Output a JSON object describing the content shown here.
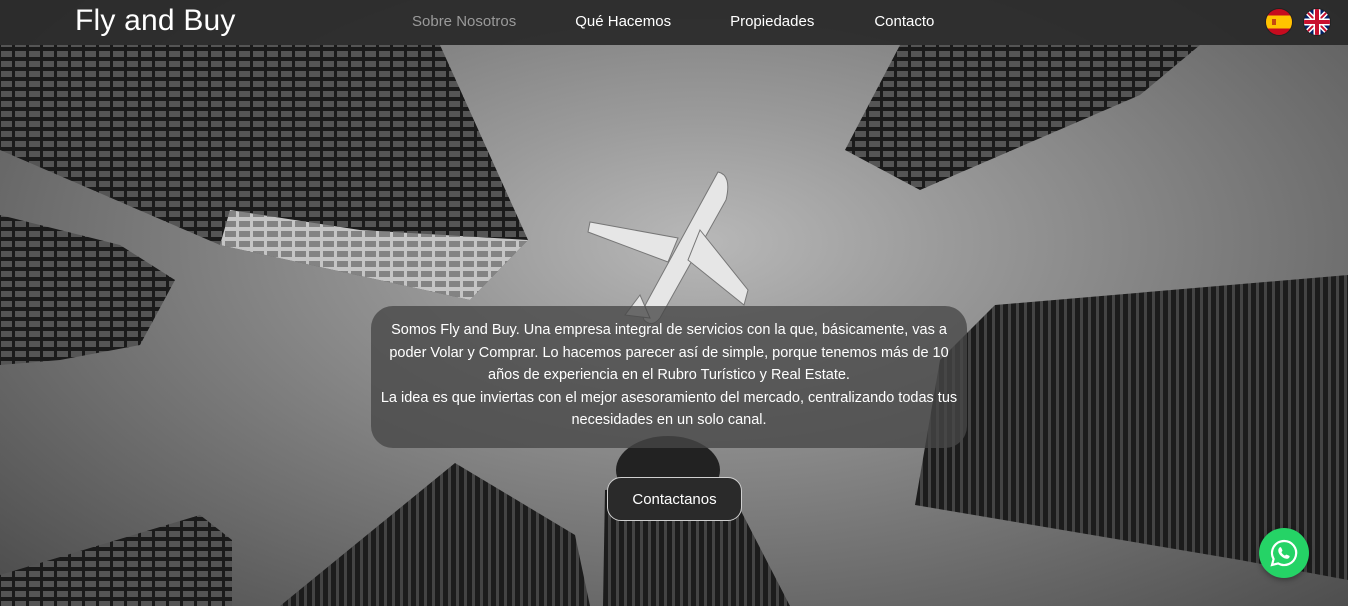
{
  "header": {
    "brand": "Fly and Buy",
    "nav": [
      {
        "label": "Sobre Nosotros",
        "active": true
      },
      {
        "label": "Qué Hacemos",
        "active": false
      },
      {
        "label": "Propiedades",
        "active": false
      },
      {
        "label": "Contacto",
        "active": false
      }
    ],
    "languages": [
      {
        "icon": "spain-flag-icon",
        "code": "es"
      },
      {
        "icon": "uk-flag-icon",
        "code": "en"
      }
    ]
  },
  "hero": {
    "intro_line1": "Somos Fly and Buy. Una empresa integral de servicios con la que, básicamente, vas a poder Volar y Comprar. Lo hacemos parecer así de simple, porque tenemos más de 10 años de experiencia en el Rubro Turístico y Real Estate.",
    "intro_line2": "La idea es que inviertas con el mejor asesoramiento del mercado, centralizando todas tus necesidades en un solo canal.",
    "cta_label": "Contactanos"
  },
  "floating": {
    "whatsapp_icon": "whatsapp-icon"
  },
  "colors": {
    "navbar_bg": "#282828",
    "active_nav": "#9a9a9a",
    "whatsapp": "#25d366"
  }
}
